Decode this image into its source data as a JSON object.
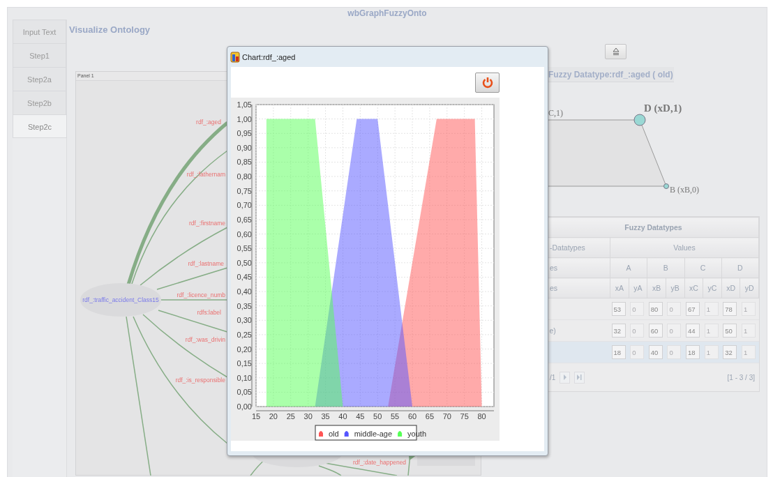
{
  "app": {
    "title": "wbGraphFuzzyOnto"
  },
  "tabs": [
    {
      "label": "Input Text",
      "selected": false
    },
    {
      "label": "Step1",
      "selected": false
    },
    {
      "label": "Step2a",
      "selected": false
    },
    {
      "label": "Step2b",
      "selected": false
    },
    {
      "label": "Step2c",
      "selected": true
    }
  ],
  "page_title": "Visualize Ontology",
  "panel": {
    "title": "Panel 1",
    "node_label": "rdf_:traffic_accident_Class15",
    "edge_labels": [
      "rdf_:aged",
      "rdf_:fathernam",
      "rdf_:firstname",
      "rdf_:lastname",
      "rdf_:licence_numb",
      "rdfs:label",
      "rdf_:was_drivin",
      "rdf_:is_responsible",
      "rdf_:date_happened"
    ]
  },
  "datatype_view": {
    "heading": "Fuzzy Datatype:rdf_:aged ( old)",
    "point_c": "C,1)",
    "point_d": "D (xD,1)",
    "point_b": "B (xB,0)"
  },
  "table": {
    "title": "Fuzzy Datatypes",
    "header_row_1": [
      "-Datatypes",
      "Values"
    ],
    "header_row_2": [
      "es",
      "A",
      "B",
      "C",
      "D"
    ],
    "header_row_3": [
      "es",
      "xA",
      "yA",
      "xB",
      "yB",
      "xC",
      "yC",
      "xD",
      "yD"
    ],
    "rows": [
      {
        "selected": false,
        "values": [
          {
            "value": "53",
            "disabled": false
          },
          {
            "value": "0",
            "disabled": true
          },
          {
            "value": "80",
            "disabled": false
          },
          {
            "value": "0",
            "disabled": true
          },
          {
            "value": "67",
            "disabled": false
          },
          {
            "value": "1",
            "disabled": true
          },
          {
            "value": "78",
            "disabled": false
          },
          {
            "value": "1",
            "disabled": true
          }
        ]
      },
      {
        "label": "e)",
        "selected": false,
        "values": [
          {
            "value": "32",
            "disabled": false
          },
          {
            "value": "0",
            "disabled": true
          },
          {
            "value": "60",
            "disabled": false
          },
          {
            "value": "0",
            "disabled": true
          },
          {
            "value": "44",
            "disabled": false
          },
          {
            "value": "1",
            "disabled": true
          },
          {
            "value": "50",
            "disabled": false
          },
          {
            "value": "1",
            "disabled": true
          }
        ]
      },
      {
        "selected": true,
        "values": [
          {
            "value": "18",
            "disabled": false
          },
          {
            "value": "0",
            "disabled": true
          },
          {
            "value": "40",
            "disabled": false
          },
          {
            "value": "0",
            "disabled": true
          },
          {
            "value": "18",
            "disabled": false
          },
          {
            "value": "1",
            "disabled": true
          },
          {
            "value": "32",
            "disabled": false
          },
          {
            "value": "1",
            "disabled": true
          }
        ]
      }
    ],
    "pager": {
      "page": "/1",
      "range": "[1 - 3 / 3]"
    }
  },
  "dialog": {
    "title": "Chart:rdf_:aged",
    "chart_data": {
      "type": "area",
      "x": [
        18,
        18,
        32,
        40,
        44,
        50,
        53,
        60,
        67,
        78,
        80
      ],
      "series": [
        {
          "name": "old",
          "color": "#ff5555",
          "values": [
            null,
            null,
            null,
            null,
            null,
            null,
            0,
            0.5,
            1,
            1,
            0
          ]
        },
        {
          "name": "middle-age",
          "color": "#5555ff",
          "values": [
            null,
            null,
            0,
            0.667,
            1,
            1,
            0.7,
            0,
            null,
            null,
            null
          ]
        },
        {
          "name": "youth",
          "color": "#55ff55",
          "values": [
            0,
            1,
            1,
            0,
            null,
            null,
            null,
            null,
            null,
            null,
            null
          ]
        }
      ],
      "xlim": [
        15,
        83.5
      ],
      "ylim": [
        0,
        1.05
      ],
      "grid": true,
      "legend": true,
      "xticks": [
        {
          "value": 15,
          "label": "15"
        },
        {
          "value": 20,
          "label": "20"
        },
        {
          "value": 25,
          "label": "25"
        },
        {
          "value": 30,
          "label": "30"
        },
        {
          "value": 35,
          "label": "35"
        },
        {
          "value": 40,
          "label": "40"
        },
        {
          "value": 45,
          "label": "45"
        },
        {
          "value": 50,
          "label": "50"
        },
        {
          "value": 55,
          "label": "55"
        },
        {
          "value": 60,
          "label": "60"
        },
        {
          "value": 65,
          "label": "65"
        },
        {
          "value": 70,
          "label": "70"
        },
        {
          "value": 75,
          "label": "75"
        },
        {
          "value": 80,
          "label": "80"
        }
      ],
      "yticks": [
        {
          "value": 0,
          "label": "0,00"
        },
        {
          "value": 0.05,
          "label": "0,05"
        },
        {
          "value": 0.1,
          "label": "0,10"
        },
        {
          "value": 0.15,
          "label": "0,15"
        },
        {
          "value": 0.2,
          "label": "0,20"
        },
        {
          "value": 0.25,
          "label": "0,25"
        },
        {
          "value": 0.3,
          "label": "0,30"
        },
        {
          "value": 0.35,
          "label": "0,35"
        },
        {
          "value": 0.4,
          "label": "0,40"
        },
        {
          "value": 0.45,
          "label": "0,45"
        },
        {
          "value": 0.5,
          "label": "0,50"
        },
        {
          "value": 0.55,
          "label": "0,55"
        },
        {
          "value": 0.6,
          "label": "0,60"
        },
        {
          "value": 0.65,
          "label": "0,65"
        },
        {
          "value": 0.7,
          "label": "0,70"
        },
        {
          "value": 0.75,
          "label": "0,75"
        },
        {
          "value": 0.8,
          "label": "0,80"
        },
        {
          "value": 0.85,
          "label": "0,85"
        },
        {
          "value": 0.9,
          "label": "0,90"
        },
        {
          "value": 0.95,
          "label": "0,95"
        },
        {
          "value": 1,
          "label": "1,00"
        },
        {
          "value": 1.05,
          "label": "1,05"
        }
      ]
    }
  }
}
